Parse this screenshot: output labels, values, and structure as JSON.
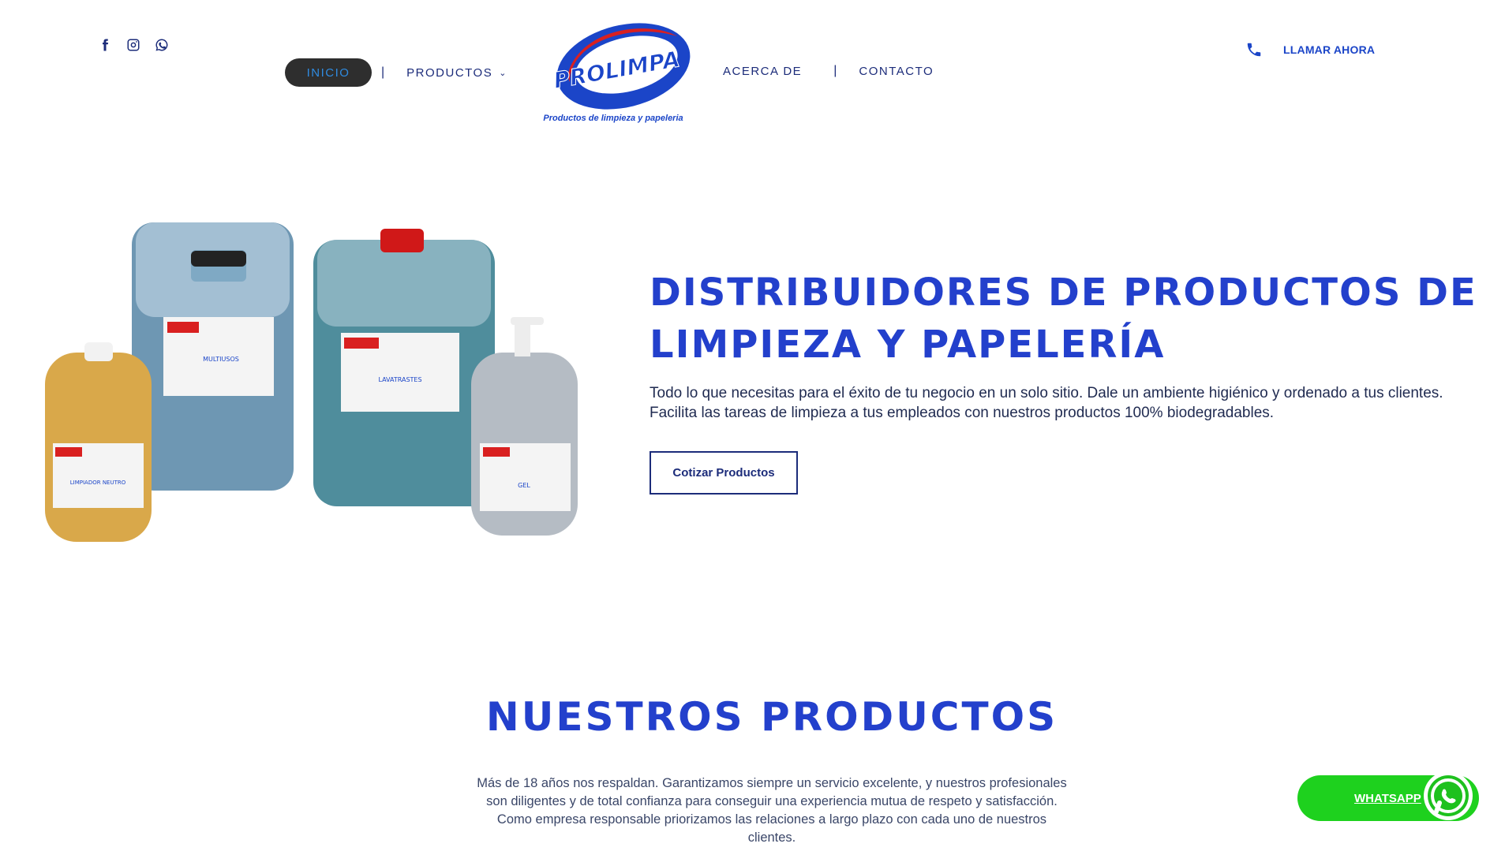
{
  "header": {
    "social_icons": [
      "facebook-icon",
      "instagram-icon",
      "whatsapp-icon"
    ],
    "nav": {
      "inicio": "INICIO",
      "separator": "|",
      "productos": "PRODUCTOS",
      "acerca": "ACERCA DE",
      "contacto": "CONTACTO"
    },
    "logo": {
      "brand": "PROLIMPA",
      "tagline": "Productos de limpieza y papeleria"
    },
    "call_label": "LLAMAR AHORA"
  },
  "hero": {
    "title_line1": "DISTRIBUIDORES DE PRODUCTOS DE",
    "title_line2": "LIMPIEZA Y PAPELERÍA",
    "text": "Todo lo que necesitas para el éxito de tu negocio en un solo sitio. Dale un ambiente higiénico y ordenado a tus clientes. Facilita las tareas de limpieza a tus empleados con nuestros productos 100% biodegradables.",
    "cta": "Cotizar Productos",
    "product_labels": [
      "MULTIUSOS",
      "LAVATRASTES",
      "LIMPIADOR NEUTRO",
      "GEL"
    ]
  },
  "products_section": {
    "title": "NUESTROS PRODUCTOS",
    "text": "Más de 18 años nos respaldan. Garantizamos siempre un servicio excelente, y nuestros profesionales son diligentes y de total confianza para conseguir una experiencia mutua de respeto y satisfacción. Como empresa responsable priorizamos las relaciones a largo plazo con cada uno de nuestros clientes."
  },
  "whatsapp": {
    "label": "WHATSAPP"
  },
  "colors": {
    "brand_blue": "#2340cc",
    "navy": "#1c2c7a",
    "whatsapp_green": "#1ed11e",
    "pill_bg": "#2e2e2e"
  }
}
